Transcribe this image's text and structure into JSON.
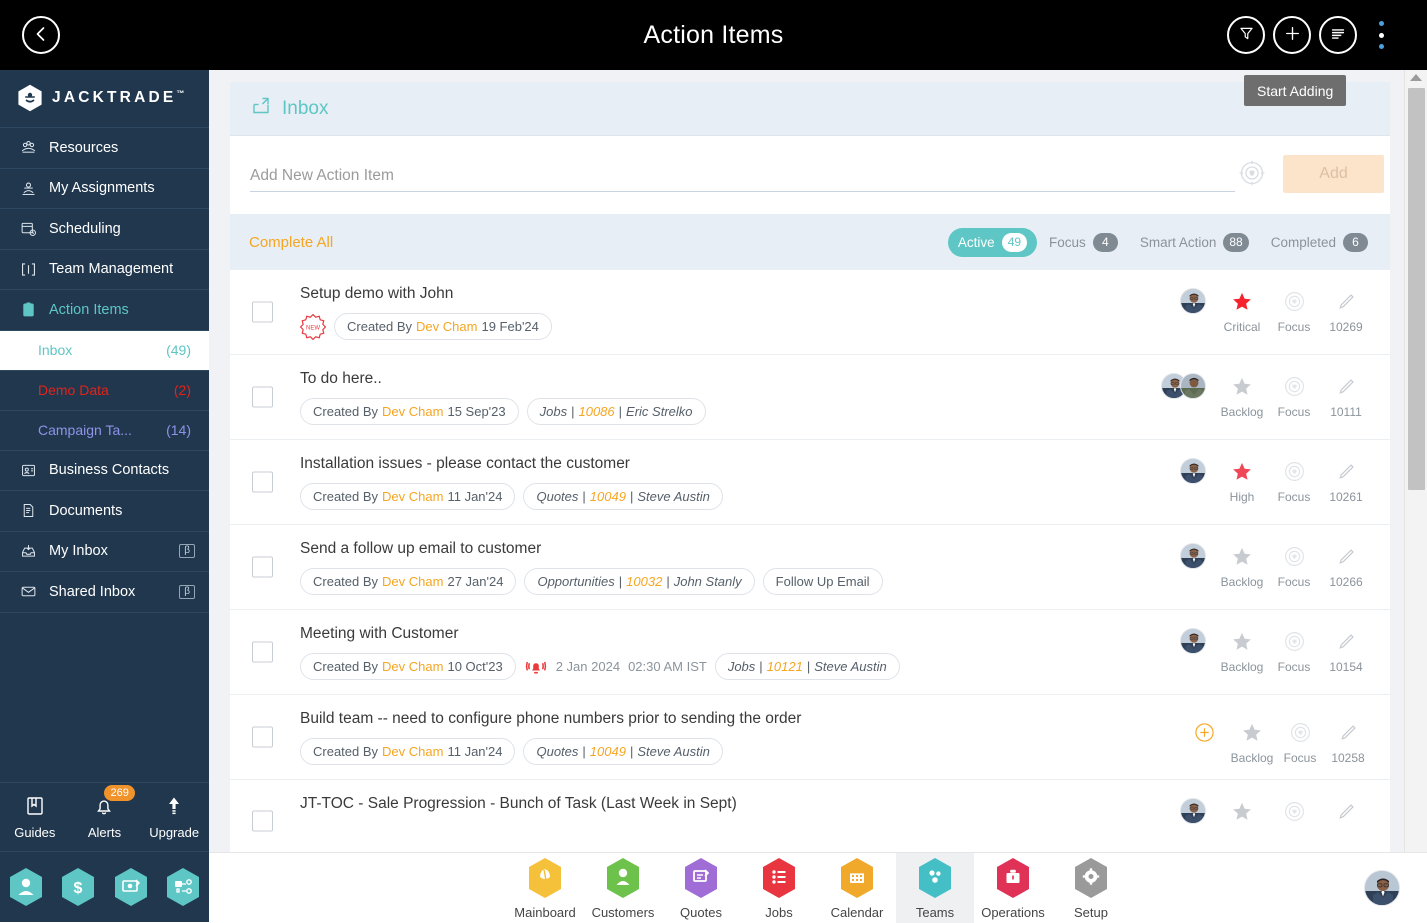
{
  "topbar": {
    "title": "Action Items",
    "back_icon": "chevron-left-icon",
    "filter_icon": "filter-funnel-icon",
    "add_icon": "plus-icon",
    "list_icon": "list-lines-icon",
    "kebab_icon": "three-dots-vertical-icon"
  },
  "tooltip": {
    "text": "Start Adding"
  },
  "sidebar": {
    "brand": {
      "name": "JACKTRADE",
      "trademark": "™",
      "logo_icon": "jacktrade-hex-logo-icon"
    },
    "items": [
      {
        "label": "Resources",
        "icon": "resources-icon",
        "active": false
      },
      {
        "label": "My Assignments",
        "icon": "assignments-icon",
        "active": false
      },
      {
        "label": "Scheduling",
        "icon": "calendar-clock-icon",
        "active": false
      },
      {
        "label": "Team Management",
        "icon": "team-brackets-icon",
        "active": false
      },
      {
        "label": "Action Items",
        "icon": "clipboard-icon",
        "active": true
      }
    ],
    "sub_items": [
      {
        "label": "Inbox",
        "count": "(49)",
        "color": "#5ec6c4",
        "selected": true
      },
      {
        "label": "Demo Data",
        "count": "(2)",
        "color": "#e62117",
        "selected": false
      },
      {
        "label": "Campaign Ta...",
        "count": "(14)",
        "color": "#8f93e8",
        "selected": false
      }
    ],
    "items_after": [
      {
        "label": "Business Contacts",
        "icon": "contact-card-icon",
        "beta": ""
      },
      {
        "label": "Documents",
        "icon": "documents-icon",
        "beta": ""
      },
      {
        "label": "My Inbox",
        "icon": "inbox-down-icon",
        "beta": "β"
      },
      {
        "label": "Shared Inbox",
        "icon": "envelope-icon",
        "beta": "β"
      }
    ],
    "tools": [
      {
        "label": "Guides",
        "icon": "book-icon",
        "badge": ""
      },
      {
        "label": "Alerts",
        "icon": "bell-icon",
        "badge": "269"
      },
      {
        "label": "Upgrade",
        "icon": "up-arrow-icon",
        "badge": ""
      }
    ],
    "hex_buttons": [
      {
        "icon": "person-hex-icon"
      },
      {
        "icon": "dollar-hex-icon"
      },
      {
        "icon": "money-transfer-hex-icon"
      },
      {
        "icon": "workflow-hex-icon"
      }
    ]
  },
  "inbox_header": {
    "label": "Inbox",
    "icon": "inbox-tray-icon"
  },
  "add_bar": {
    "placeholder": "Add New Action Item",
    "value": "",
    "target_icon": "target-shield-icon",
    "add_label": "Add"
  },
  "filter_bar": {
    "complete_all_label": "Complete All",
    "tabs": [
      {
        "label": "Active",
        "count": "49",
        "active": true
      },
      {
        "label": "Focus",
        "count": "4",
        "active": false
      },
      {
        "label": "Smart Action",
        "count": "88",
        "active": false
      },
      {
        "label": "Completed",
        "count": "6",
        "active": false
      }
    ]
  },
  "rows": [
    {
      "title": "Setup demo with John",
      "new_badge": "NEW",
      "chips": [
        {
          "type": "created",
          "prefix": "Created By",
          "author": "Dev Cham",
          "date": "19 Feb'24"
        }
      ],
      "avatars": 1,
      "priority": "Critical",
      "priority_color": "#f5232d",
      "focus_label": "Focus",
      "id": "10269"
    },
    {
      "title": "To do here..",
      "new_badge": "",
      "chips": [
        {
          "type": "created",
          "prefix": "Created By",
          "author": "Dev Cham",
          "date": "15 Sep'23"
        },
        {
          "type": "ref",
          "entity": "Jobs",
          "number": "10086",
          "person": "Eric Strelko"
        }
      ],
      "avatars": 2,
      "priority": "Backlog",
      "priority_color": "#c8ccd1",
      "focus_label": "Focus",
      "id": "10111"
    },
    {
      "title": "Installation issues - please contact the customer",
      "new_badge": "",
      "chips": [
        {
          "type": "created",
          "prefix": "Created By",
          "author": "Dev Cham",
          "date": "11 Jan'24"
        },
        {
          "type": "ref",
          "entity": "Quotes",
          "number": "10049",
          "person": "Steve Austin"
        }
      ],
      "avatars": 1,
      "priority": "High",
      "priority_color": "#ef4755",
      "focus_label": "Focus",
      "id": "10261"
    },
    {
      "title": "Send a follow up email to customer",
      "new_badge": "",
      "chips": [
        {
          "type": "created",
          "prefix": "Created By",
          "author": "Dev Cham",
          "date": "27 Jan'24"
        },
        {
          "type": "ref",
          "entity": "Opportunities",
          "number": "10032",
          "person": "John Stanly"
        },
        {
          "type": "plain",
          "text": "Follow Up Email"
        }
      ],
      "avatars": 1,
      "priority": "Backlog",
      "priority_color": "#c8ccd1",
      "focus_label": "Focus",
      "id": "10266"
    },
    {
      "title": "Meeting with Customer",
      "new_badge": "",
      "chips": [
        {
          "type": "created",
          "prefix": "Created By",
          "author": "Dev Cham",
          "date": "10 Oct'23"
        },
        {
          "type": "reminder",
          "icon": "alarm-bell-icon",
          "date": "2 Jan 2024",
          "time": "02:30 AM IST"
        },
        {
          "type": "ref",
          "entity": "Jobs",
          "number": "10121",
          "person": "Steve Austin"
        }
      ],
      "avatars": 1,
      "priority": "Backlog",
      "priority_color": "#c8ccd1",
      "focus_label": "Focus",
      "id": "10154"
    },
    {
      "title": "Build team -- need to configure phone numbers prior to sending the order",
      "new_badge": "",
      "compact": true,
      "chips": [
        {
          "type": "created",
          "prefix": "Created By",
          "author": "Dev Cham",
          "date": "11 Jan'24"
        },
        {
          "type": "ref",
          "entity": "Quotes",
          "number": "10049",
          "person": "Steve Austin"
        }
      ],
      "avatars": 0,
      "add_person_icon": "plus-circle-icon",
      "priority": "Backlog",
      "priority_color": "#c8ccd1",
      "focus_label": "Focus",
      "id": "10258"
    },
    {
      "title": "JT-TOC - Sale Progression - Bunch of Task (Last Week in Sept)",
      "new_badge": "",
      "chips": [],
      "avatars": 1,
      "priority": "",
      "priority_color": "#c8ccd1",
      "focus_label": "",
      "id": ""
    }
  ],
  "bottom_nav": [
    {
      "label": "Mainboard",
      "color": "#f5c13b",
      "icon": "mainboard-icon",
      "active": false
    },
    {
      "label": "Customers",
      "color": "#6cc24a",
      "icon": "customers-person-icon",
      "active": false
    },
    {
      "label": "Quotes",
      "color": "#a06cd5",
      "icon": "quotes-icon",
      "active": false
    },
    {
      "label": "Jobs",
      "color": "#e8353f",
      "icon": "jobs-list-icon",
      "active": false
    },
    {
      "label": "Calendar",
      "color": "#f0a92b",
      "icon": "calendar-icon",
      "active": false
    },
    {
      "label": "Teams",
      "color": "#44bfc6",
      "icon": "teams-icon",
      "active": true
    },
    {
      "label": "Operations",
      "color": "#e03156",
      "icon": "operations-briefcase-icon",
      "active": false
    },
    {
      "label": "Setup",
      "color": "#9a9a9a",
      "icon": "gear-icon",
      "active": false
    }
  ],
  "bottom_avatar": {
    "icon": "user-avatar"
  },
  "colors": {
    "sidebar_bg": "#20374e",
    "accent_teal": "#5ec6c4",
    "accent_orange": "#f5a623",
    "topbar_bg": "#000000",
    "main_bg": "#f0f2f5"
  }
}
